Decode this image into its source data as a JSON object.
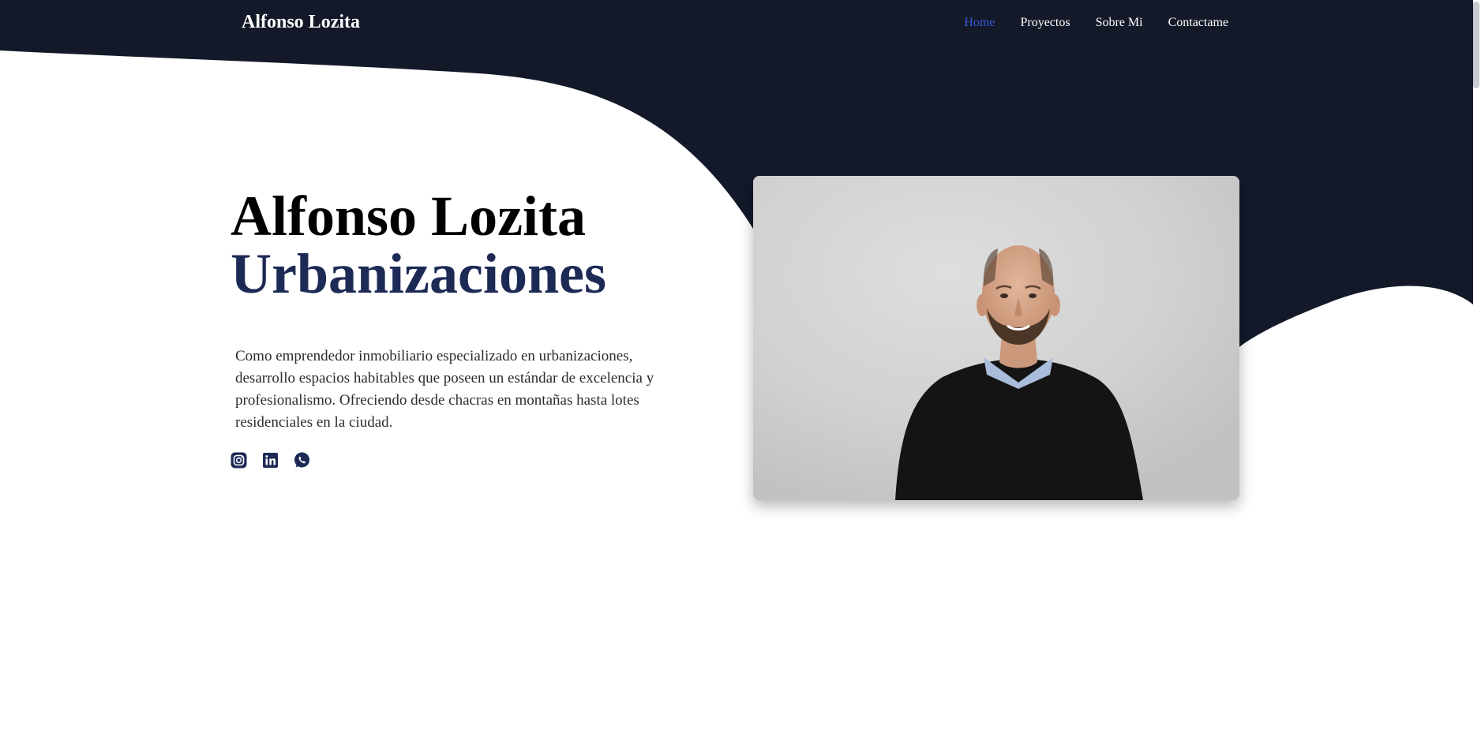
{
  "nav": {
    "brand": "Alfonso Lozita",
    "links": [
      {
        "label": "Home",
        "active": true
      },
      {
        "label": "Proyectos",
        "active": false
      },
      {
        "label": "Sobre Mi",
        "active": false
      },
      {
        "label": "Contactame",
        "active": false
      }
    ]
  },
  "hero": {
    "title": "Alfonso Lozita",
    "subtitle": "Urbanizaciones",
    "description": "Como emprendedor inmobiliario especializado en urbanizaciones, desarrollo espacios habitables que poseen un estándar de excelencia y profesionalismo. Ofreciendo desde chacras en montañas hasta lotes residenciales en la ciudad.",
    "socials": [
      "instagram-icon",
      "linkedin-icon",
      "whatsapp-icon"
    ]
  },
  "colors": {
    "navy": "#131929",
    "accent": "#1d2a55",
    "active_link": "#3b5bdb"
  }
}
